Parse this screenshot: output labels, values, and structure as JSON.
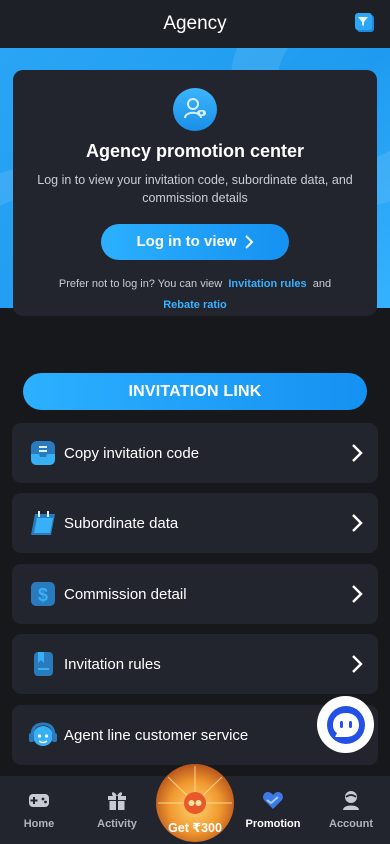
{
  "header": {
    "title": "Agency",
    "filter_icon": "filter-icon"
  },
  "colors": {
    "accent": "#1e9bf0",
    "card": "#23252e",
    "background": "#17181c",
    "link": "#39b1ff"
  },
  "promo": {
    "title": "Agency promotion center",
    "description": "Log in to view your invitation code, subordinate data, and commission details",
    "login_label": "Log in to view",
    "prefer_text": "Prefer not to log in? You can view",
    "link_rules": "Invitation rules",
    "and_text": "and",
    "link_rebate": "Rebate ratio"
  },
  "invitation_banner": "INVITATION LINK",
  "menu": [
    {
      "label": "Copy invitation code",
      "icon": "inbox-icon"
    },
    {
      "label": "Subordinate data",
      "icon": "calendar-icon"
    },
    {
      "label": "Commission detail",
      "icon": "dollar-icon"
    },
    {
      "label": "Invitation rules",
      "icon": "bookmark-icon"
    },
    {
      "label": "Agent line customer service",
      "icon": "headset-icon"
    }
  ],
  "tabs": [
    {
      "label": "Home",
      "icon": "gamepad-icon"
    },
    {
      "label": "Activity",
      "icon": "gift-icon"
    },
    {
      "label": "Get ₹300",
      "icon": "wheel-icon"
    },
    {
      "label": "Promotion",
      "icon": "heart-icon"
    },
    {
      "label": "Account",
      "icon": "user-icon"
    }
  ]
}
